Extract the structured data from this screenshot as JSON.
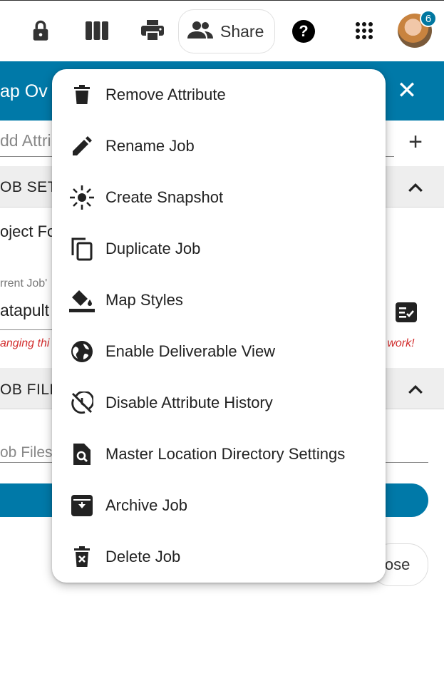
{
  "toolbar": {
    "icons": [
      "lock-icon",
      "columns-icon",
      "print-icon",
      "help-icon",
      "apps-grid-icon"
    ],
    "share_label": "Share",
    "help_glyph": "?",
    "notification_count": "6"
  },
  "panel": {
    "title": "ap Ov",
    "close_glyph": "✕",
    "add_attribute_placeholder": "dd Attrib",
    "add_glyph": "+",
    "job_settings_label": "OB SETT",
    "project_folder_label": "oject Fo",
    "current_job_label": "rrent Job'",
    "current_job_value": "atapult",
    "warning_left": "anging thi",
    "warning_right": "n work!",
    "job_files_label": "OB FILES",
    "job_files_placeholder": "ob Files",
    "close_button_label": "lose"
  },
  "menu": {
    "items": [
      {
        "label": "Remove Attribute",
        "icon": "trash-icon"
      },
      {
        "label": "Rename Job",
        "icon": "pencil-icon"
      },
      {
        "label": "Create Snapshot",
        "icon": "snapshot-icon"
      },
      {
        "label": "Duplicate Job",
        "icon": "copy-icon"
      },
      {
        "label": "Map Styles",
        "icon": "paint-bucket-icon"
      },
      {
        "label": "Enable Deliverable View",
        "icon": "globe-icon"
      },
      {
        "label": "Disable Attribute History",
        "icon": "history-off-icon"
      },
      {
        "label": "Master Location Directory Settings",
        "icon": "search-file-icon"
      },
      {
        "label": "Archive Job",
        "icon": "archive-icon"
      },
      {
        "label": "Delete Job",
        "icon": "delete-icon"
      }
    ]
  },
  "colors": {
    "header_blue": "#0079a8",
    "badge_blue": "#0077a0",
    "warning_red": "#d32f2f",
    "menu_background": "#ffffff"
  }
}
